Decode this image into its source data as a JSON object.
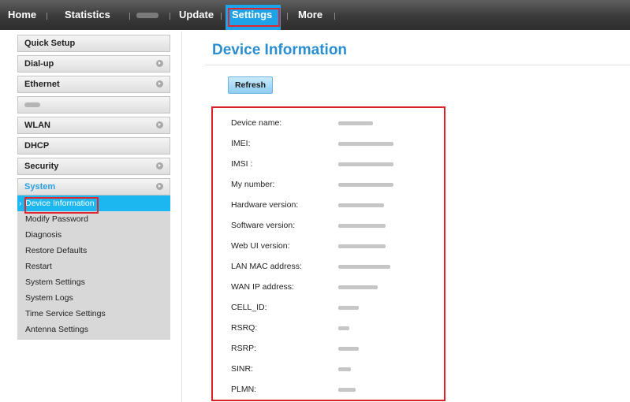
{
  "nav": {
    "home": "Home",
    "statistics": "Statistics",
    "update": "Update",
    "settings": "Settings",
    "more": "More"
  },
  "sidebar": {
    "items": [
      {
        "label": "Quick Setup",
        "expandable": false
      },
      {
        "label": "Dial-up",
        "expandable": true
      },
      {
        "label": "Ethernet",
        "expandable": true
      },
      {
        "label": "",
        "expandable": false
      },
      {
        "label": "WLAN",
        "expandable": true
      },
      {
        "label": "DHCP",
        "expandable": false
      },
      {
        "label": "Security",
        "expandable": true
      },
      {
        "label": "System",
        "expandable": true,
        "active": true
      }
    ],
    "system_submenu": [
      "Device Information",
      "Modify Password",
      "Diagnosis",
      "Restore Defaults",
      "Restart",
      "System Settings",
      "System Logs",
      "Time Service Settings",
      "Antenna Settings"
    ]
  },
  "main": {
    "title": "Device Information",
    "refresh_label": "Refresh",
    "info_labels": [
      "Device name:",
      "IMEI:",
      "IMSI :",
      "My number:",
      "Hardware version:",
      "Software version:",
      "Web UI version:",
      "LAN MAC address:",
      "WAN IP address:",
      "CELL_ID:",
      "RSRQ:",
      "RSRP:",
      "SINR:",
      "PLMN:"
    ]
  },
  "colors": {
    "accent_blue": "#1fa3e8",
    "title_blue": "#2a8fd0",
    "highlight_red": "#e0262d",
    "nav_bg": "#3a3a3a"
  },
  "icons": {
    "expand": "chevron-right-circle-icon"
  }
}
